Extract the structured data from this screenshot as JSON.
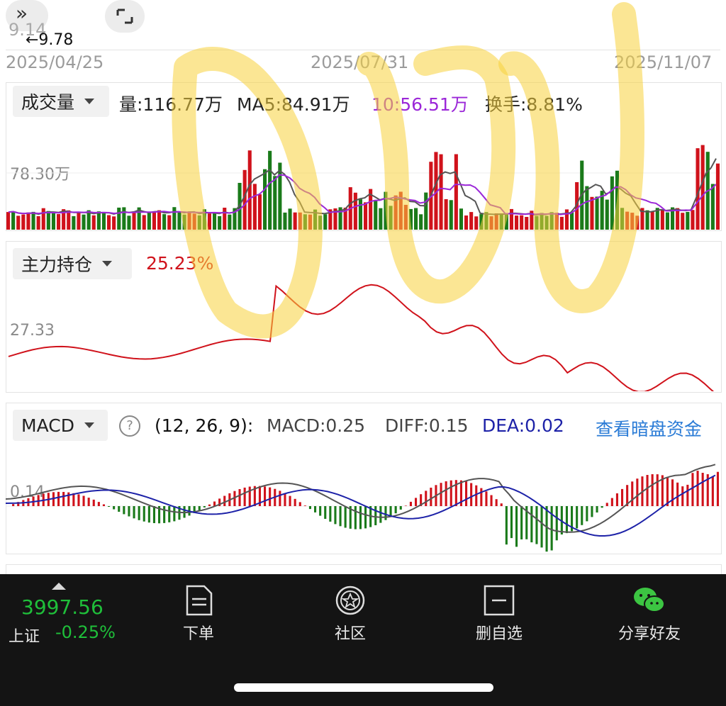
{
  "top": {
    "price_fragment": "9.14",
    "ref_price": "←9.78"
  },
  "dates": [
    "2025/04/25",
    "2025/07/31",
    "2025/11/07"
  ],
  "volume_panel": {
    "selector": "成交量",
    "vol": "量:116.77万",
    "ma5": "MA5:84.91万",
    "ma10": "10:56.51万",
    "turnover": "换手:8.81%",
    "ylabel": "78.30万"
  },
  "holding_panel": {
    "selector": "主力持仓",
    "value": "25.23%",
    "ylabel": "27.33"
  },
  "macd_panel": {
    "selector": "MACD",
    "params": "(12, 26, 9):",
    "macd": "MACD:0.25",
    "diff": "DIFF:0.15",
    "dea": "DEA:0.02",
    "link": "查看暗盘资金",
    "ylabel": "0.14"
  },
  "colors": {
    "up": "#d0121b",
    "down": "#1a7a1a",
    "ma5": "#555555",
    "ma10": "#9b27d8",
    "dea": "#1d22a8",
    "link": "#2a7bd6"
  },
  "index": {
    "price": "3997.56",
    "name": "上证",
    "change": "-0.25%"
  },
  "tabs": [
    "下单",
    "社区",
    "删自选",
    "分享好友"
  ]
}
